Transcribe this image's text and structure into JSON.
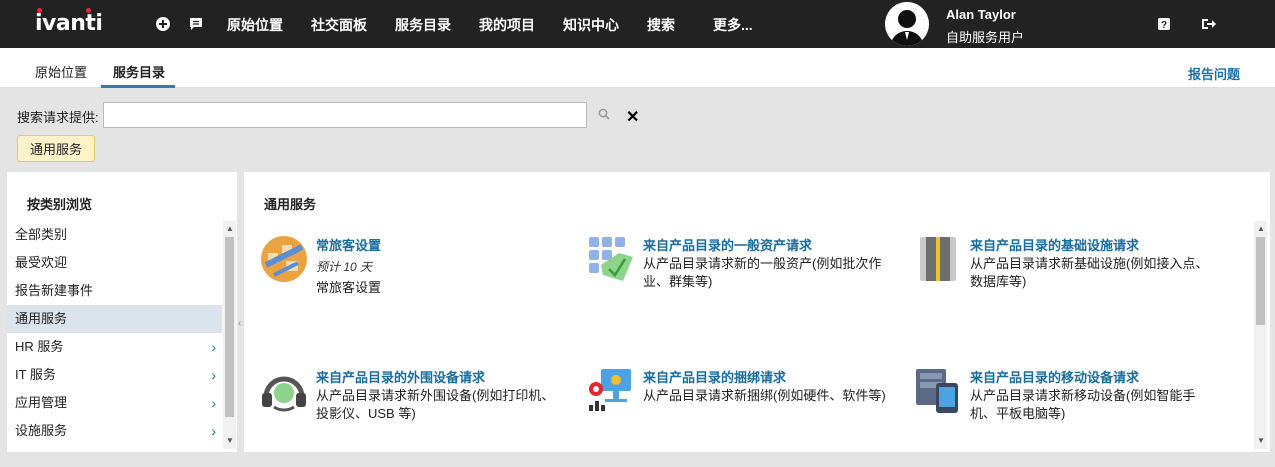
{
  "header": {
    "logo": "ivanti",
    "nav": [
      "原始位置",
      "社交面板",
      "服务目录",
      "我的项目",
      "知识中心",
      "搜索",
      "更多..."
    ],
    "user_name": "Alan Taylor",
    "user_role": "自助服务用户"
  },
  "tabs": [
    "原始位置",
    "服务目录"
  ],
  "report_link": "报告问题",
  "search": {
    "label": "搜索请求提供:",
    "value": ""
  },
  "chip": "通用服务",
  "sidebar": {
    "title": "按类别浏览",
    "items": [
      {
        "label": "全部类别"
      },
      {
        "label": "最受欢迎"
      },
      {
        "label": "报告新建事件"
      },
      {
        "label": "通用服务"
      },
      {
        "label": "HR 服务"
      },
      {
        "label": "IT 服务"
      },
      {
        "label": "应用管理"
      },
      {
        "label": "设施服务"
      }
    ]
  },
  "main": {
    "title": "通用服务",
    "cards": [
      {
        "title": "常旅客设置",
        "meta": "预计 10 天",
        "desc": "常旅客设置"
      },
      {
        "title": "来自产品目录的一般资产请求",
        "desc": "从产品目录请求新的一般资产(例如批次作业、群集等)"
      },
      {
        "title": "来自产品目录的基础设施请求",
        "desc": "从产品目录请求新基础设施(例如接入点、数据库等)"
      },
      {
        "title": "来自产品目录的外围设备请求",
        "desc": "从产品目录请求新外围设备(例如打印机、投影仪、USB 等)"
      },
      {
        "title": "来自产品目录的捆绑请求",
        "desc": "从产品目录请求新捆绑(例如硬件、软件等)"
      },
      {
        "title": "来自产品目录的移动设备请求",
        "desc": "从产品目录请求新移动设备(例如智能手机、平板电脑等)"
      }
    ]
  },
  "colors": {
    "header_bg": "#222222",
    "accent": "#1a73a8",
    "chip_bg": "#fdf2c8"
  }
}
